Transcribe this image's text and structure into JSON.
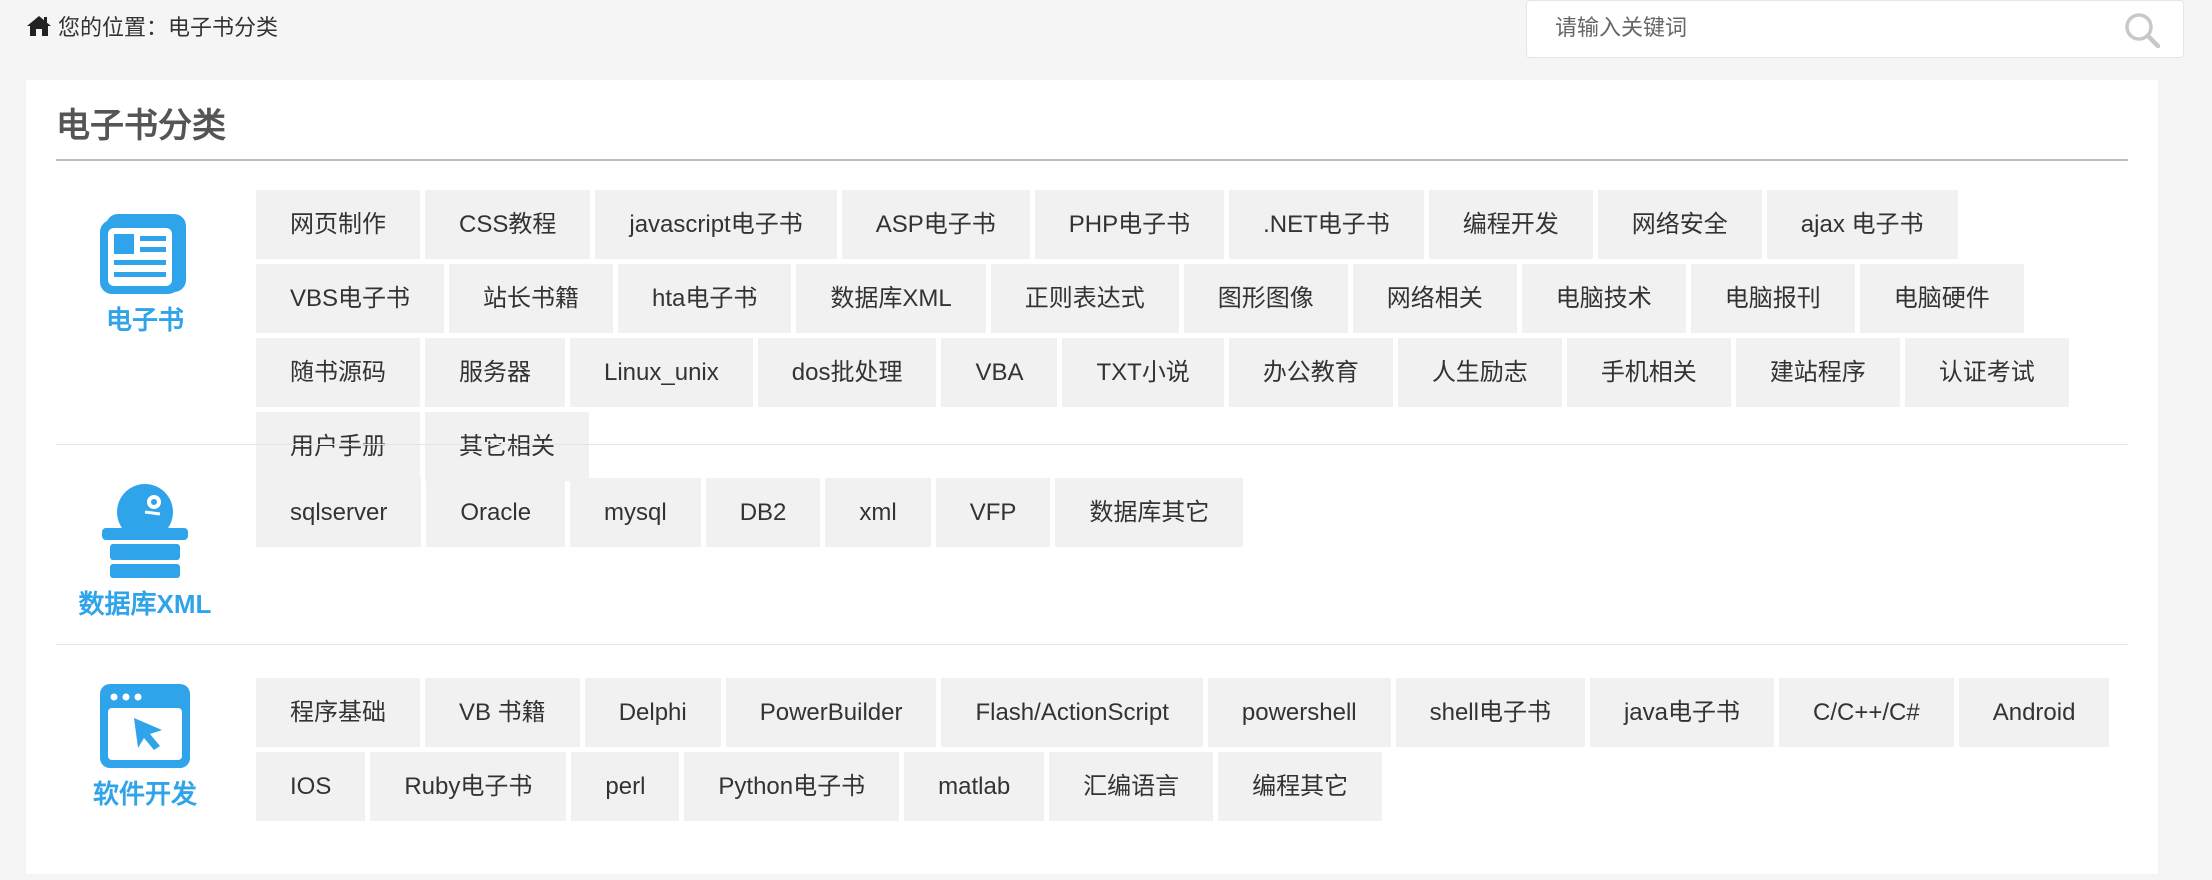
{
  "breadcrumb": {
    "text": "您的位置：电子书分类"
  },
  "search": {
    "placeholder": "请输入关键词",
    "value": ""
  },
  "panel": {
    "title": "电子书分类"
  },
  "categories": [
    {
      "label": "电子书",
      "icon": "ebook-document-icon",
      "tags": [
        "网页制作",
        "CSS教程",
        "javascript电子书",
        "ASP电子书",
        "PHP电子书",
        ".NET电子书",
        "编程开发",
        "网络安全",
        "ajax 电子书",
        "VBS电子书",
        "站长书籍",
        "hta电子书",
        "数据库XML",
        "正则表达式",
        "图形图像",
        "网络相关",
        "电脑技术",
        "电脑报刊",
        "电脑硬件",
        "随书源码",
        "服务器",
        "Linux_unix",
        "dos批处理",
        "VBA",
        "TXT小说",
        "办公教育",
        "人生励志",
        "手机相关",
        "建站程序",
        "认证考试",
        "用户手册",
        "其它相关"
      ]
    },
    {
      "label": "数据库XML",
      "icon": "database-robot-icon",
      "tags": [
        "sqlserver",
        "Oracle",
        "mysql",
        "DB2",
        "xml",
        "VFP",
        "数据库其它"
      ]
    },
    {
      "label": "软件开发",
      "icon": "software-window-cursor-icon",
      "tags": [
        "程序基础",
        "VB 书籍",
        "Delphi",
        "PowerBuilder",
        "Flash/ActionScript",
        "powershell",
        "shell电子书",
        "java电子书",
        "C/C++/C#",
        "Android",
        "IOS",
        "Ruby电子书",
        "perl",
        "Python电子书",
        "matlab",
        "汇编语言",
        "编程其它"
      ]
    }
  ],
  "colors": {
    "accent": "#2fa4ea",
    "tag_bg": "#f1f1f1",
    "page_bg": "#f5f5f5"
  }
}
